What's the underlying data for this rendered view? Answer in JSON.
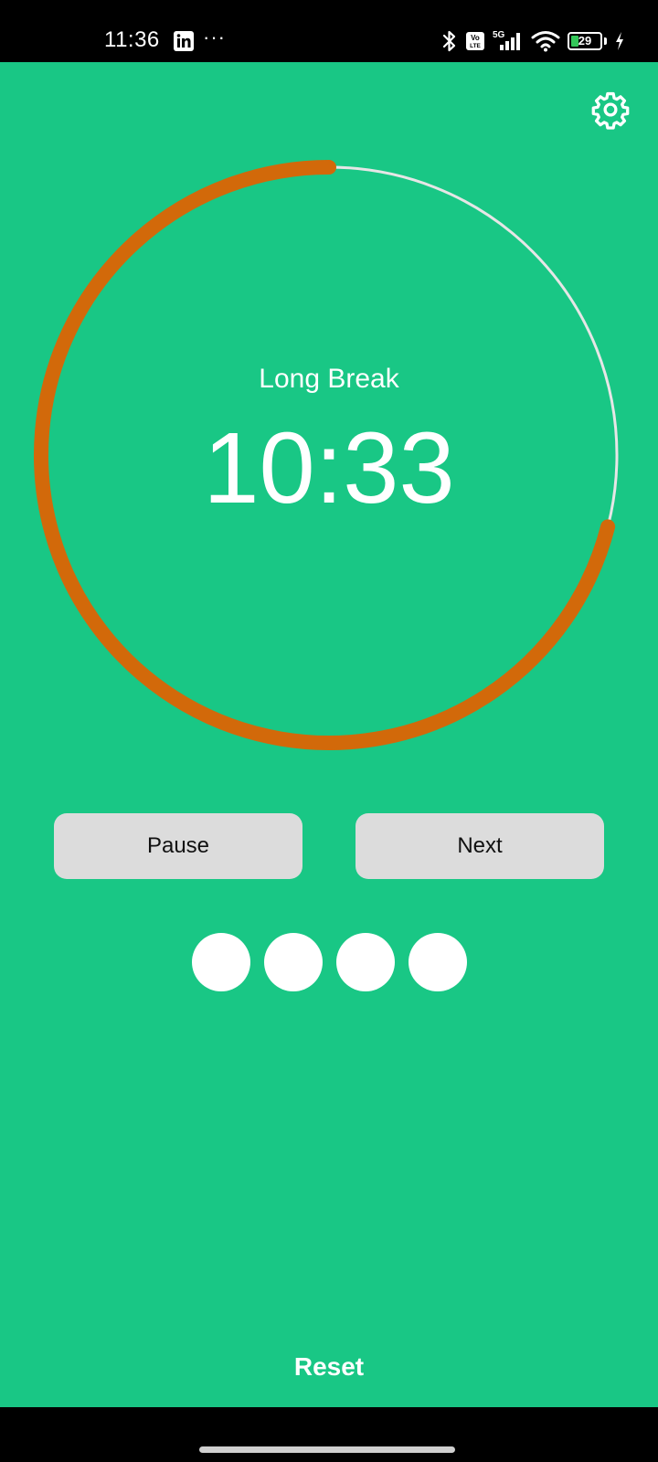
{
  "status_bar": {
    "time": "11:36",
    "more": "···",
    "battery_level": "29",
    "network_label": "5G",
    "volte_label": "Vo LTE"
  },
  "timer": {
    "mode_label": "Long Break",
    "time_remaining": "10:33",
    "progress_elapsed_fraction": 0.29,
    "track_color": "#e6e6e6",
    "progress_color": "#d2690a",
    "background_color": "#19c785"
  },
  "controls": {
    "pause_label": "Pause",
    "next_label": "Next"
  },
  "session_indicators": {
    "count": 4,
    "completed_color": "#ffffff"
  },
  "footer": {
    "reset_label": "Reset"
  },
  "icons": {
    "settings": "gear-icon",
    "linkedin": "linkedin-icon",
    "bluetooth": "bluetooth-icon",
    "signal": "signal-icon",
    "wifi": "wifi-icon",
    "charging": "charging-icon"
  }
}
